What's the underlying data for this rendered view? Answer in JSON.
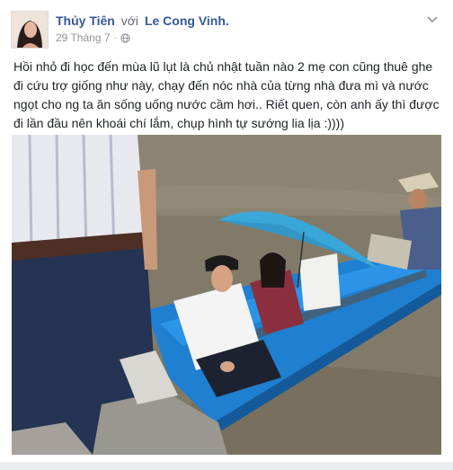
{
  "post": {
    "author": "Thủy Tiên",
    "with_word": "với",
    "tagged": "Le Cong Vinh.",
    "date": "29 Tháng 7",
    "dot": "·",
    "privacy_icon": "globe-icon",
    "menu_icon": "chevron-down-icon",
    "body": "Hồi nhỏ đi học đến mùa lũ lụt là chủ nhật tuần nào 2 mẹ con cũng thuê ghe đi cứu trợ giống như này, chạy đến nóc nhà của từng nhà đưa mì và nước ngọt cho ng ta ăn sống uống nước cầm hơi.. Riết quen, còn anh ấy thì được đi lần đầu nên khoái chí lắm, chụp hình tự sướng lia lịa :))))"
  },
  "colors": {
    "link": "#365899",
    "meta": "#90949c",
    "text": "#1d2129",
    "boat": "#1f7fd0",
    "umbrella": "#3aa7d9",
    "water": "#7f7866"
  }
}
